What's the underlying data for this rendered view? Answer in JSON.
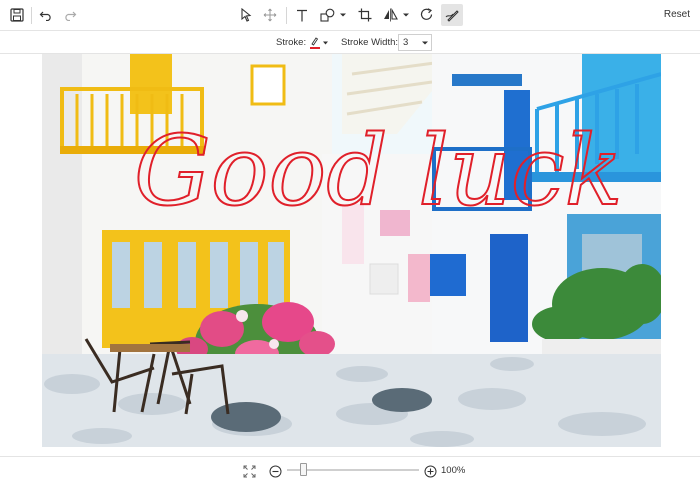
{
  "toolbar": {
    "reset_label": "Reset",
    "icons": [
      "save-icon",
      "undo-icon",
      "redo-icon",
      "select-icon",
      "pan-icon",
      "text-icon",
      "shape-icon",
      "crop-icon",
      "flip-icon",
      "rotate-icon",
      "freehand-draw-icon"
    ]
  },
  "stroke_bar": {
    "stroke_label": "Stroke:",
    "stroke_color": "#e0202a",
    "width_label": "Stroke Width:",
    "width_value": "3"
  },
  "canvas": {
    "annotation_text": "Good luck",
    "annotation_color": "#e0202a"
  },
  "zoom": {
    "level": 0.12,
    "label": "100%"
  }
}
